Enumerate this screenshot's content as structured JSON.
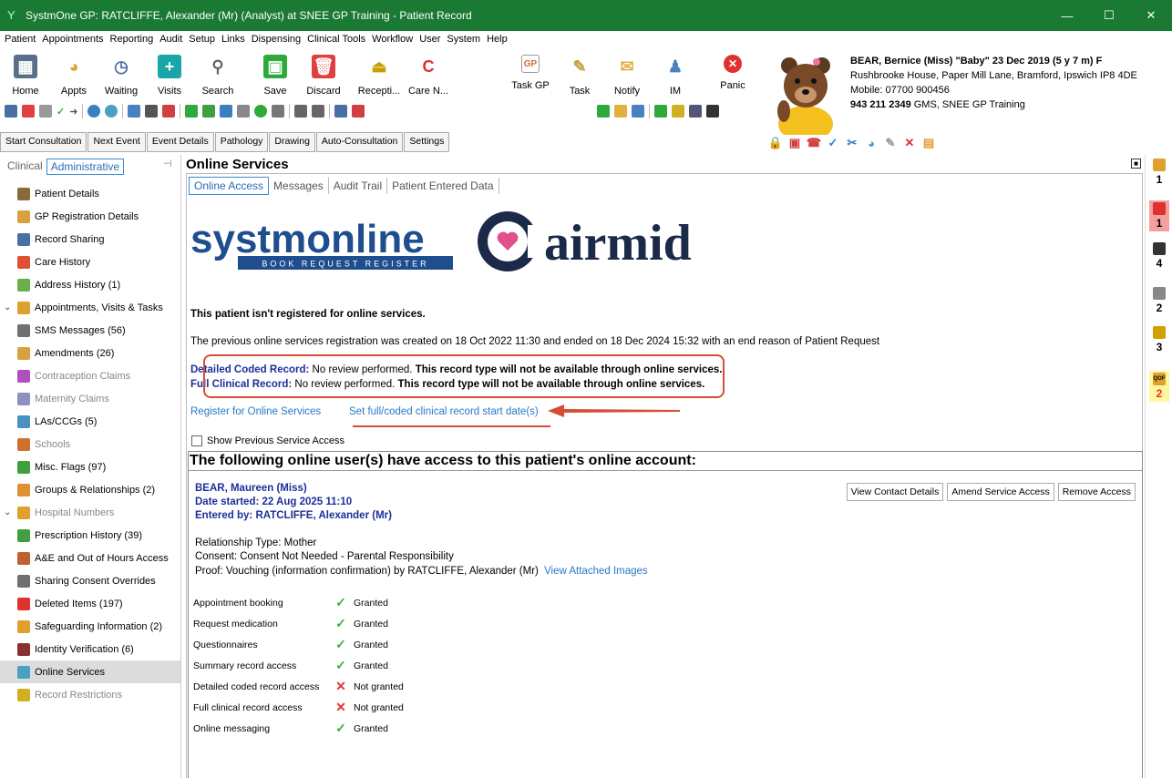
{
  "window": {
    "title": "SystmOne GP: RATCLIFFE, Alexander (Mr) (Analyst) at SNEE GP Training - Patient Record",
    "min": "—",
    "max": "☐",
    "close": "✕"
  },
  "menu": [
    "Patient",
    "Appointments",
    "Reporting",
    "Audit",
    "Setup",
    "Links",
    "Dispensing",
    "Clinical Tools",
    "Workflow",
    "User",
    "System",
    "Help"
  ],
  "toolbar": {
    "big_buttons": [
      {
        "label": "Home",
        "icon": "home-icon",
        "color": "#5a6f8a"
      },
      {
        "label": "Appts",
        "icon": "appointments-icon",
        "color": "#e0a030"
      },
      {
        "label": "Waiting",
        "icon": "waiting-icon",
        "color": "#4a6fa5"
      },
      {
        "label": "Visits",
        "icon": "visits-icon",
        "color": "#1aa6a6"
      },
      {
        "label": "Search",
        "icon": "search-icon",
        "color": "#666666"
      },
      {
        "label": "Save",
        "icon": "save-icon",
        "color": "#2eaa3a"
      },
      {
        "label": "Discard",
        "icon": "discard-icon",
        "color": "#e04040"
      },
      {
        "label": "Recepti...",
        "icon": "reception-icon",
        "color": "#c8a000"
      },
      {
        "label": "Care N...",
        "icon": "care-navigation-icon",
        "color": "#e03030"
      },
      {
        "label": "Task GP",
        "icon": "task-gp-icon",
        "color": "#d06a3a"
      },
      {
        "label": "Task",
        "icon": "task-icon",
        "color": "#c8a040"
      },
      {
        "label": "Notify",
        "icon": "notify-icon",
        "color": "#e0b040"
      },
      {
        "label": "IM",
        "icon": "im-icon",
        "color": "#4a7fc0"
      },
      {
        "label": "Panic",
        "icon": "panic-icon",
        "color": "#e03030"
      }
    ]
  },
  "patient": {
    "name_line": "BEAR, Bernice (Miss) \"Baby\" 23 Dec 2019 (5 y 7 m) F",
    "address": "Rushbrooke House, Paper Mill Lane, Bramford, Ipswich IP8 4DE",
    "mobile": "Mobile: 07700 900456",
    "nhs_line": "943 211 2349",
    "practice": "GMS, SNEE GP Training"
  },
  "commands": [
    "Start Consultation",
    "Next Event",
    "Event Details",
    "Pathology",
    "Drawing",
    "Auto-Consultation",
    "Settings"
  ],
  "left_tabs": {
    "clinical": "Clinical",
    "administrative": "Administrative"
  },
  "nav": [
    {
      "label": "Patient Details",
      "type": "item",
      "color": "#8a6a3a",
      "grey": false
    },
    {
      "label": "GP Registration Details",
      "type": "item",
      "color": "#d9a040",
      "grey": false
    },
    {
      "label": "Record Sharing",
      "type": "item",
      "color": "#4a6fa5",
      "grey": false
    },
    {
      "label": "Care History",
      "type": "item",
      "color": "#e05030",
      "grey": false
    },
    {
      "label": "Address History (1)",
      "type": "item",
      "color": "#6ab04a",
      "grey": false
    },
    {
      "label": "Appointments, Visits & Tasks",
      "type": "group",
      "color": "#e0a030",
      "grey": false
    },
    {
      "label": "SMS Messages (56)",
      "type": "item",
      "color": "#707070",
      "grey": false
    },
    {
      "label": "Amendments (26)",
      "type": "item",
      "color": "#d9a040",
      "grey": false
    },
    {
      "label": "Contraception Claims",
      "type": "item",
      "color": "#b050c0",
      "grey": true
    },
    {
      "label": "Maternity Claims",
      "type": "item",
      "color": "#9090c0",
      "grey": true
    },
    {
      "label": "LAs/CCGs (5)",
      "type": "item",
      "color": "#4a90c0",
      "grey": false
    },
    {
      "label": "Schools",
      "type": "item",
      "color": "#d07030",
      "grey": true
    },
    {
      "label": "Misc. Flags (97)",
      "type": "item",
      "color": "#40a040",
      "grey": false
    },
    {
      "label": "Groups & Relationships (2)",
      "type": "item",
      "color": "#e09030",
      "grey": false
    },
    {
      "label": "Hospital Numbers",
      "type": "group",
      "color": "#e0a030",
      "grey": true
    },
    {
      "label": "Prescription History (39)",
      "type": "item",
      "color": "#40a040",
      "grey": false
    },
    {
      "label": "A&E and Out of Hours Access",
      "type": "item",
      "color": "#c06030",
      "grey": false
    },
    {
      "label": "Sharing Consent Overrides",
      "type": "item",
      "color": "#707070",
      "grey": false
    },
    {
      "label": "Deleted Items (197)",
      "type": "item",
      "color": "#e03030",
      "grey": false
    },
    {
      "label": "Safeguarding Information (2)",
      "type": "item",
      "color": "#e0a030",
      "grey": false
    },
    {
      "label": "Identity Verification (6)",
      "type": "item",
      "color": "#8a3030",
      "grey": false
    },
    {
      "label": "Online Services",
      "type": "item",
      "color": "#4aa0c0",
      "grey": false,
      "selected": true
    },
    {
      "label": "Record Restrictions",
      "type": "item",
      "color": "#d0b020",
      "grey": true
    }
  ],
  "main": {
    "title": "Online Services",
    "tabs": [
      "Online Access",
      "Messages",
      "Audit Trail",
      "Patient Entered Data"
    ],
    "logo1_main": "systmonline",
    "logo1_sub": "BOOK  REQUEST  REGISTER",
    "logo2_text": "airmid",
    "not_registered": "This patient isn't registered for online services.",
    "previous": "The previous online services registration was created on 18 Oct 2022 11:30 and ended on 18 Dec 2024 15:32 with an end reason of Patient Request",
    "detailed_label": "Detailed Coded Record:",
    "detailed_review": " No review performed. ",
    "detailed_note": "This record type will not be available through online services.",
    "full_label": "Full Clinical Record:",
    "full_review": " No review performed. ",
    "full_note": "This record type will not be available through online services.",
    "register_link": "Register for Online Services",
    "start_date_link": "Set full/coded clinical record start date(s)",
    "show_previous": "Show Previous Service Access",
    "users_heading": "The following online user(s) have access to this patient's online account:"
  },
  "user": {
    "name": "BEAR, Maureen (Miss)",
    "date_started": "Date started: 22 Aug 2025 11:10",
    "entered_by": "Entered by: RATCLIFFE, Alexander (Mr)",
    "relationship": "Relationship Type: Mother",
    "consent": "Consent: Consent Not Needed - Parental Responsibility",
    "proof": "Proof: Vouching (information confirmation) by RATCLIFFE, Alexander (Mr)",
    "view_images": "View Attached Images",
    "buttons": [
      "View Contact Details",
      "Amend Service Access",
      "Remove Access"
    ],
    "permissions": [
      {
        "name": "Appointment booking",
        "granted": true,
        "status": "Granted"
      },
      {
        "name": "Request medication",
        "granted": true,
        "status": "Granted"
      },
      {
        "name": "Questionnaires",
        "granted": true,
        "status": "Granted"
      },
      {
        "name": "Summary record access",
        "granted": true,
        "status": "Granted"
      },
      {
        "name": "Detailed coded record access",
        "granted": false,
        "status": "Not granted"
      },
      {
        "name": "Full clinical record access",
        "granted": false,
        "status": "Not granted"
      },
      {
        "name": "Online messaging",
        "granted": true,
        "status": "Granted"
      }
    ]
  },
  "right_strip": [
    {
      "count": "1",
      "icon": "document-icon",
      "color": "#e0a030"
    },
    {
      "count": "1",
      "icon": "double-alert-icon",
      "color": "#e03030",
      "highlight": "#f5a0a0"
    },
    {
      "count": "4",
      "icon": "alert-icon",
      "color": "#333333"
    },
    {
      "count": "2",
      "icon": "clipboard-icon",
      "color": "#888888"
    },
    {
      "count": "3",
      "icon": "warning-icon",
      "color": "#d0a000"
    },
    {
      "count": "2",
      "icon": "qof-icon",
      "color": "#e0a030",
      "highlight": "#fff7a0",
      "label": "QOF"
    }
  ],
  "colors": {
    "titlebar": "#1a7a33",
    "link": "#2a78c9",
    "label_blue": "#1c2f9a",
    "annotation_red": "#d64d36"
  }
}
